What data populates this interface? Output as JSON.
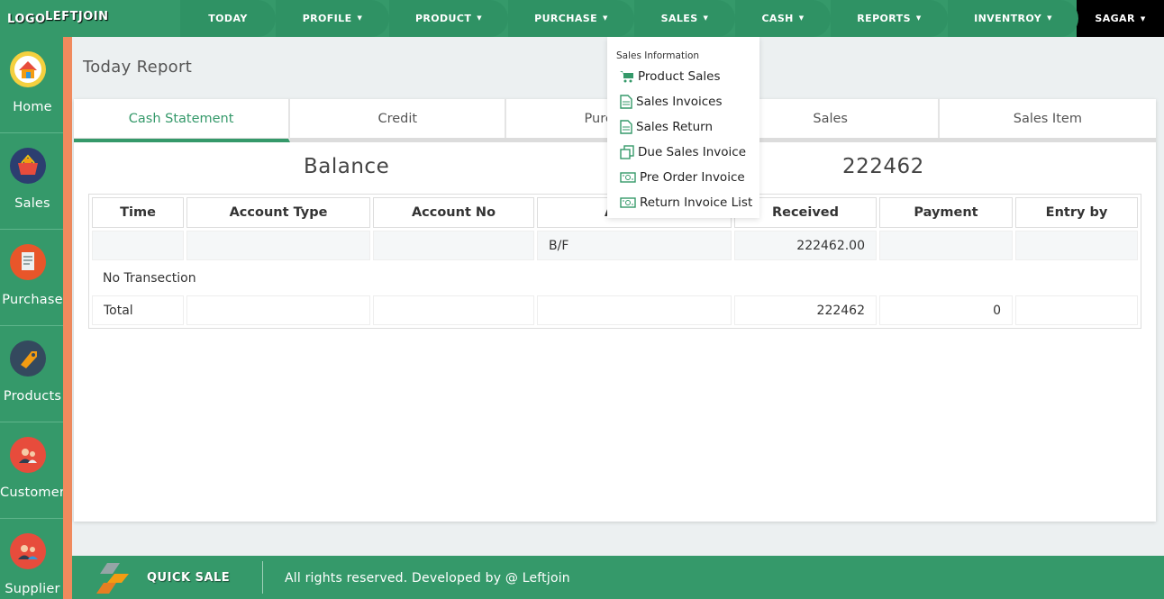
{
  "brand": {
    "logo_text": "LOGO",
    "name": "LEFTJOIN"
  },
  "nav": {
    "items": [
      {
        "label": "TODAY",
        "caret": false
      },
      {
        "label": "PROFILE",
        "caret": true
      },
      {
        "label": "PRODUCT",
        "caret": true
      },
      {
        "label": "PURCHASE",
        "caret": true
      },
      {
        "label": "SALES",
        "caret": true
      },
      {
        "label": "CASH",
        "caret": true
      },
      {
        "label": "REPORTS",
        "caret": true
      },
      {
        "label": "INVENTROY",
        "caret": true
      }
    ],
    "user": "SAGAR",
    "colors": {
      "bar": "#35996a",
      "pill": "#2f9264",
      "user_bg": "#000000"
    }
  },
  "sidebar": {
    "items": [
      {
        "label": "Home",
        "icon": "home-icon"
      },
      {
        "label": "Sales",
        "icon": "sales-basket-icon"
      },
      {
        "label": "Purchase",
        "icon": "purchase-document-icon"
      },
      {
        "label": "Products",
        "icon": "tag-icon"
      },
      {
        "label": "Customer",
        "icon": "customer-icon"
      },
      {
        "label": "Supplier",
        "icon": "supplier-icon"
      }
    ]
  },
  "page": {
    "title": "Today Report"
  },
  "tabs": [
    {
      "label": "Cash Statement",
      "active": true
    },
    {
      "label": "Credit",
      "active": false
    },
    {
      "label": "Purchase",
      "active": false
    },
    {
      "label": "Sales",
      "active": false
    },
    {
      "label": "Sales Item",
      "active": false
    }
  ],
  "balance": {
    "label": "Balance",
    "value": "222462"
  },
  "table": {
    "headers": [
      "Time",
      "Account Type",
      "Account No",
      "Account",
      "Received",
      "Payment",
      "Entry by"
    ],
    "bf_row": {
      "account": "B/F",
      "received": "222462.00"
    },
    "empty_message": "No Transection",
    "total_row": {
      "label": "Total",
      "received": "222462",
      "payment": "0"
    }
  },
  "sales_dropdown": {
    "header": "Sales Information",
    "items": [
      {
        "label": "Product Sales",
        "icon": "cart-icon"
      },
      {
        "label": "Sales Invoices",
        "icon": "document-icon"
      },
      {
        "label": "Sales Return",
        "icon": "document-icon"
      },
      {
        "label": "Due Sales Invoice",
        "icon": "copy-icon"
      },
      {
        "label": "Pre Order Invoice",
        "icon": "money-icon"
      },
      {
        "label": "Return Invoice List",
        "icon": "money-icon"
      }
    ]
  },
  "footer": {
    "quick_sale": "QUICK SALE",
    "copyright": "All rights reserved. Developed by @ Leftjoin"
  }
}
